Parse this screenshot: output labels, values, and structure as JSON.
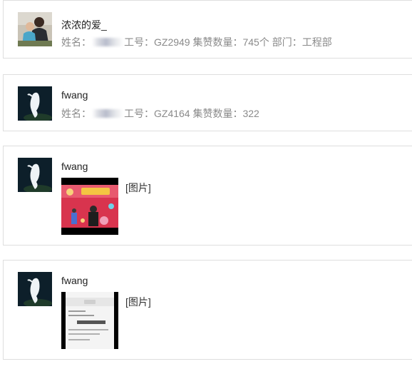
{
  "messages": [
    {
      "name": "浓浓的爱_",
      "meta": {
        "name_label": "姓名：",
        "id_text": "工号：GZ2949",
        "likes_text": "集赞数量：745个",
        "dept_text": "部门：工程部"
      }
    },
    {
      "name": "fwang",
      "meta": {
        "name_label": "姓名：",
        "id_text": "工号：GZ4164",
        "likes_text": "集赞数量：322"
      }
    },
    {
      "name": "fwang",
      "image_label": "[图片]"
    },
    {
      "name": "fwang",
      "image_label": "[图片]"
    }
  ],
  "colors": {
    "border": "#dedede",
    "meta_text": "#8a8a8a",
    "name_text": "#222222"
  },
  "icons": {
    "avatar_1": "family-photo-avatar",
    "avatar_2": "ghost-figure-avatar"
  }
}
